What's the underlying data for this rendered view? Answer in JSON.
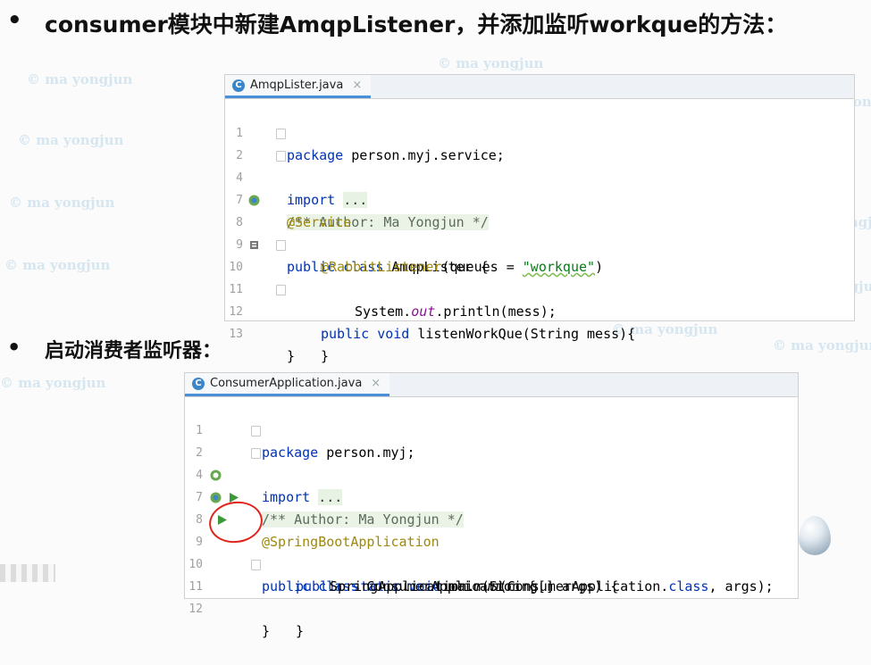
{
  "heading1": {
    "bullet": "•",
    "text": "consumer模块中新建AmqpListener，并添加监听workque的方法："
  },
  "heading2": {
    "bullet": "•",
    "text": "启动消费者监听器："
  },
  "watermark": "© ma yongjun",
  "editor1": {
    "tab": {
      "icon": "C",
      "filename": "AmqpLister.java",
      "close": "×"
    },
    "lines": [
      {
        "n": "1",
        "c1": "",
        "c2": "package person.myj.service;"
      },
      {
        "n": "2",
        "k": "import",
        "f": "..."
      },
      {
        "n": "4",
        "cm": "/** Author: Ma Yongjun */"
      },
      {
        "n": "7",
        "an": "@Service"
      },
      {
        "n": "8",
        "k1": "public class",
        "t": " AmqpLister {"
      },
      {
        "n": "9",
        "an": "@RabbitListener",
        "p1": "(queues = ",
        "s": "\"workque\"",
        "p2": ")"
      },
      {
        "n": "10",
        "k1": "public void",
        "t": " listenWorkQue(String mess){"
      },
      {
        "n": "11",
        "a": "System.",
        "i": "out",
        "b": ".println(mess);"
      },
      {
        "n": "12",
        "t": "}"
      },
      {
        "n": "13",
        "t": "}"
      }
    ]
  },
  "editor2": {
    "tab": {
      "icon": "C",
      "filename": "ConsumerApplication.java",
      "close": "×"
    },
    "lines": [
      {
        "n": "1",
        "t": "package person.myj;"
      },
      {
        "n": "2",
        "k": "import",
        "f": "..."
      },
      {
        "n": "4",
        "cm": "/** Author: Ma Yongjun */"
      },
      {
        "n": "7",
        "an": "@SpringBootApplication"
      },
      {
        "n": "8",
        "k1": "public class",
        "t": " ConsumerApplication {"
      },
      {
        "n": "9",
        "k1": "public static void",
        "t": " main(String[] args) {"
      },
      {
        "n": "10",
        "a": "SpringApplication.",
        "i": "run",
        "b": "(ConsumerApplication.",
        "k2": "class",
        "c": ", args);"
      },
      {
        "n": "11",
        "t": "}"
      },
      {
        "n": "12",
        "t": "}"
      }
    ]
  }
}
